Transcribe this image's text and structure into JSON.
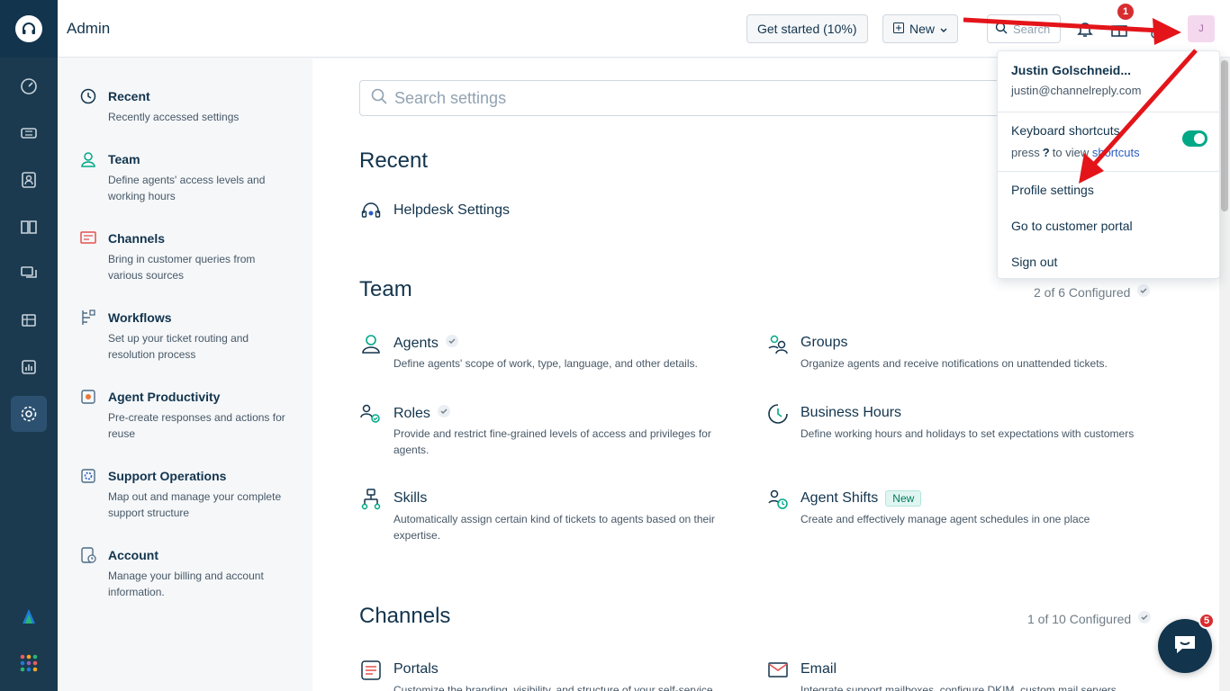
{
  "header": {
    "title": "Admin",
    "get_started": "Get started (10%)",
    "new_label": "New",
    "search_placeholder": "Search",
    "notification_count": "1",
    "avatar_initial": "J"
  },
  "sidebar": {
    "items": [
      {
        "name": "Recent",
        "desc": "Recently accessed settings",
        "icon": "history-icon"
      },
      {
        "name": "Team",
        "desc": "Define agents' access levels and working hours",
        "icon": "user-icon"
      },
      {
        "name": "Channels",
        "desc": "Bring in customer queries from various sources",
        "icon": "message-icon"
      },
      {
        "name": "Workflows",
        "desc": "Set up your ticket routing and resolution process",
        "icon": "workflow-icon"
      },
      {
        "name": "Agent Productivity",
        "desc": "Pre-create responses and actions for reuse",
        "icon": "productivity-icon"
      },
      {
        "name": "Support Operations",
        "desc": "Map out and manage your complete support structure",
        "icon": "operations-icon"
      },
      {
        "name": "Account",
        "desc": "Manage your billing and account information.",
        "icon": "account-icon"
      }
    ]
  },
  "main": {
    "search_placeholder": "Search settings",
    "recent": {
      "title": "Recent",
      "items": [
        {
          "name": "Helpdesk Settings",
          "icon": "headset-gear-icon"
        }
      ]
    },
    "team": {
      "title": "Team",
      "configured": "2 of 6 Configured",
      "cards": [
        {
          "name": "Agents",
          "desc": "Define agents' scope of work, type, language, and other details.",
          "check": true
        },
        {
          "name": "Groups",
          "desc": "Organize agents and receive notifications on unattended tickets."
        },
        {
          "name": "Roles",
          "desc": "Provide and restrict fine-grained levels of access and privileges for agents.",
          "check": true
        },
        {
          "name": "Business Hours",
          "desc": "Define working hours and holidays to set expectations with customers"
        },
        {
          "name": "Skills",
          "desc": "Automatically assign certain kind of tickets to agents based on their expertise."
        },
        {
          "name": "Agent Shifts",
          "desc": "Create and effectively manage agent schedules in one place",
          "tag": "New"
        }
      ]
    },
    "channels": {
      "title": "Channels",
      "configured": "1 of 10 Configured",
      "cards": [
        {
          "name": "Portals",
          "desc": "Customize the branding, visibility, and structure of your self-service"
        },
        {
          "name": "Email",
          "desc": "Integrate support mailboxes, configure DKIM, custom mail servers"
        }
      ]
    }
  },
  "profile_menu": {
    "name": "Justin Golschneid...",
    "email": "justin@channelreply.com",
    "keyboard_shortcuts": "Keyboard shortcuts",
    "press": "press",
    "key": "?",
    "to_view": "to view",
    "shortcuts_link": "shortcuts",
    "toggle_on": true,
    "profile_settings": "Profile settings",
    "customer_portal": "Go to customer portal",
    "sign_out": "Sign out"
  },
  "chat": {
    "badge": "5"
  },
  "colors": {
    "rail": "#1b3a4f",
    "accent": "#00a886",
    "annotation": "#e3151a"
  }
}
